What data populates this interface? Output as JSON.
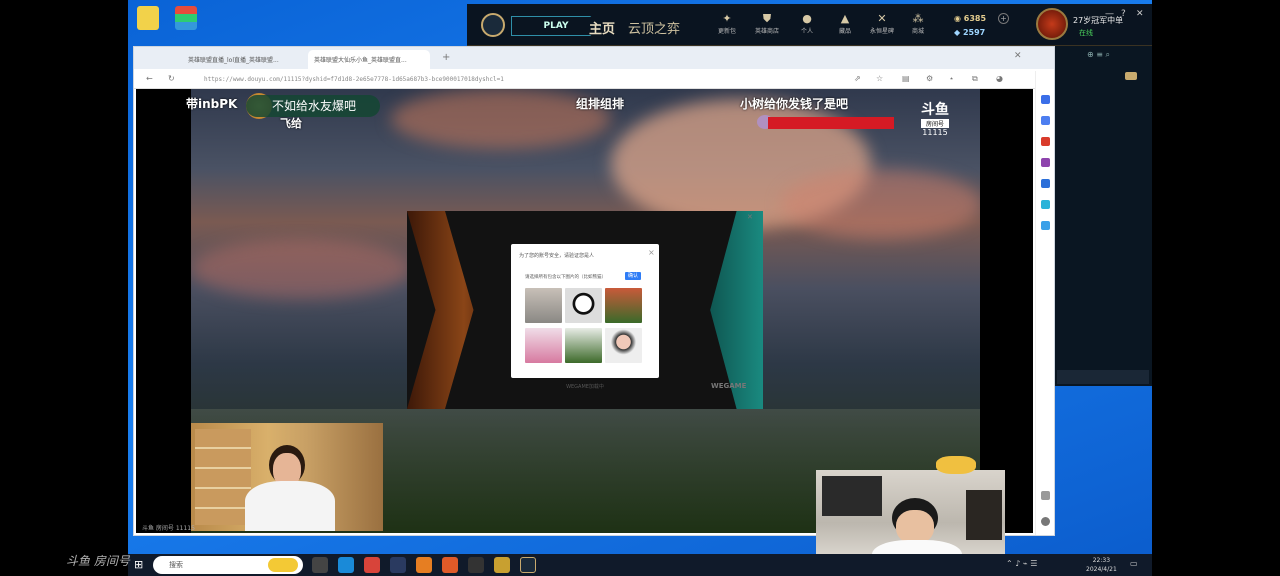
{
  "lol_client": {
    "play_label": "PLAY",
    "nav_home": "主页",
    "nav_tft": "云顶之弈",
    "tools": [
      "更新包",
      "英雄商店",
      "个人",
      "藏品",
      "永恒星碑",
      "商城"
    ],
    "currency_be": "6385",
    "currency_rp": "2597",
    "summoner_name": "27岁冠军中单",
    "summoner_status": "在线",
    "window_controls": [
      "—",
      "?",
      "✕"
    ]
  },
  "browser": {
    "tabs": [
      "英雄联盟直播_lol直播_英雄联盟...",
      "英雄联盟大仙乐小鱼_英雄联盟直..."
    ],
    "url": "https://www.douyu.com/11115?dyshid=f7d1d8-2e65e7778-1d65a687b3-bce900017018dyshcl=1"
  },
  "stream": {
    "top_left": "带inbPK",
    "badge": "不如给水友爆吧",
    "below_badge": "飞给",
    "center_text": "组排组排",
    "right_text": "小树给你发钱了是吧",
    "logo_text": "斗鱼",
    "logo_sub": "房间号",
    "room_id": "11115",
    "bottom_left": "斗鱼 房间号 11115"
  },
  "captcha": {
    "title": "为了您的账号安全，请验证您是人",
    "instruction": "请选择所有包含以下图片的（比如熊猫）",
    "confirm_label": "确认",
    "close": "×",
    "loading": "WEGAME加载中"
  },
  "wegame_logo": "WEGAME",
  "taskbar": {
    "search_placeholder": "搜索",
    "time": "22:33",
    "date": "2024/4/21"
  },
  "watermark": "斗鱼 房间号"
}
